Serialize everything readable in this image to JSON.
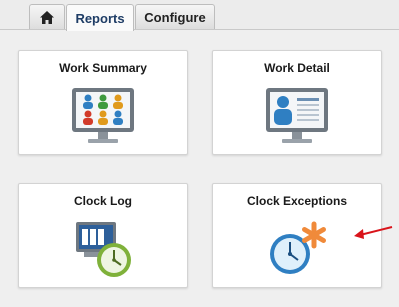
{
  "tabs": [
    {
      "label": "",
      "icon": "home-icon"
    },
    {
      "label": "Reports",
      "active": true
    },
    {
      "label": "Configure"
    }
  ],
  "cards": [
    {
      "title": "Work Summary",
      "icon": "team-monitor-icon"
    },
    {
      "title": "Work Detail",
      "icon": "profile-monitor-icon"
    },
    {
      "title": "Clock Log",
      "icon": "clock-log-icon"
    },
    {
      "title": "Clock Exceptions",
      "icon": "clock-exception-icon"
    }
  ],
  "annotation": {
    "icon": "red-arrow-icon",
    "color": "#d9141b"
  }
}
